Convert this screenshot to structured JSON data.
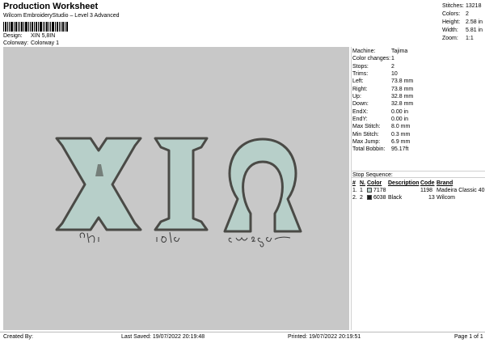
{
  "header": {
    "title": "Production Worksheet",
    "subtitle": "Wilcom EmbroideryStudio – Level 3 Advanced",
    "design_label": "Design:",
    "design_value": "XIN 5,8IN",
    "colorway_label": "Colorway:",
    "colorway_value": "Colorway 1"
  },
  "summary": [
    {
      "label": "Stitches:",
      "value": "13218"
    },
    {
      "label": "Colors:",
      "value": "2"
    },
    {
      "label": "Height:",
      "value": "2.58 in"
    },
    {
      "label": "Width:",
      "value": "5.81 in"
    },
    {
      "label": "Zoom:",
      "value": "1:1"
    }
  ],
  "design": {
    "letters": [
      "X",
      "I",
      "Ω"
    ],
    "captions": [
      "chi",
      "iota",
      "omega"
    ],
    "colors": {
      "fill": "#b7cfc9",
      "outline": "#4a4a46",
      "caption": "#3a3a3a",
      "background": "#c8c8c8"
    }
  },
  "machine_stats": [
    {
      "label": "Machine:",
      "value": "Tajima"
    },
    {
      "label": "Color changes:",
      "value": "1"
    },
    {
      "label": "Stops:",
      "value": "2"
    },
    {
      "label": "Trims:",
      "value": "10"
    },
    {
      "label": "Left:",
      "value": "73.8 mm"
    },
    {
      "label": "Right:",
      "value": "73.8 mm"
    },
    {
      "label": "Up:",
      "value": "32.8 mm"
    },
    {
      "label": "Down:",
      "value": "32.8 mm"
    },
    {
      "label": "EndX:",
      "value": "0.00 in"
    },
    {
      "label": "EndY:",
      "value": "0.00 in"
    },
    {
      "label": "Max Stitch:",
      "value": "8.0 mm"
    },
    {
      "label": "Min Stitch:",
      "value": "0.3 mm"
    },
    {
      "label": "Max Jump:",
      "value": "6.9 mm"
    },
    {
      "label": "Total Bobbin:",
      "value": "95.17ft"
    }
  ],
  "stop_sequence": {
    "title": "Stop Sequence:",
    "headers": {
      "num": "#",
      "n": "N.",
      "color": "Color",
      "description": "Description",
      "code": "Code",
      "brand": "Brand"
    },
    "rows": [
      {
        "num": "1.",
        "n": "1",
        "swatch": "#b7cfc9",
        "color": "7178",
        "description": "",
        "code": "1198",
        "brand": "Madeira Classic 40"
      },
      {
        "num": "2.",
        "n": "2",
        "swatch": "#1a1a1a",
        "color": "6038",
        "description": "Black",
        "code": "13",
        "brand": "Wilcom"
      }
    ]
  },
  "footer": {
    "created_by": "Created By:",
    "last_saved": "Last Saved: 19/07/2022 20:19:48",
    "printed": "Printed: 19/07/2022 20:19:51",
    "page": "Page 1 of 1"
  }
}
